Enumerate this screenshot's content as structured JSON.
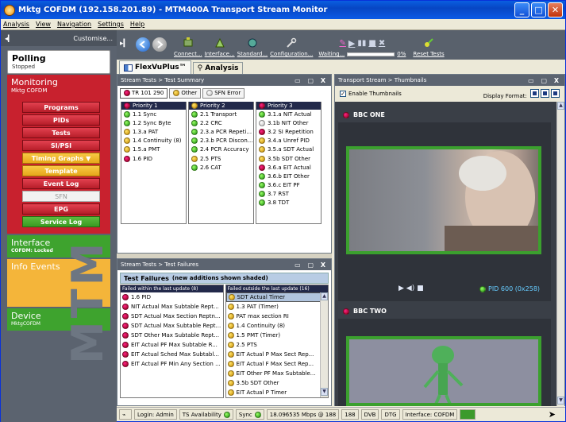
{
  "window": {
    "title": "Mktg COFDM (192.158.201.89) - MTM400A Transport Stream Monitor"
  },
  "menu": [
    "Analysis",
    "View",
    "Navigation",
    "Settings",
    "Help"
  ],
  "sidebar": {
    "header_label": "Customise...",
    "polling": {
      "title": "Polling",
      "status": "Stopped"
    },
    "monitoring": {
      "title": "Monitoring",
      "subtitle": "Mktg COFDM"
    },
    "monitoring_buttons": [
      "Programs",
      "PIDs",
      "Tests",
      "SI/PSI",
      "Timing Graphs",
      "Template",
      "Event Log",
      "SFN",
      "EPG",
      "Service Log"
    ],
    "interface": {
      "title": "Interface",
      "subtitle": "COFDM: Locked"
    },
    "info_events": {
      "title": "Info Events"
    },
    "device": {
      "title": "Device",
      "subtitle": "MktgCOFDM"
    },
    "brand_text": "MTM"
  },
  "toolbar": {
    "connect": "Connect...",
    "interface": "Interface...",
    "standard": "Standard...",
    "configuration": "Configuration...",
    "waiting": "Waiting...",
    "progress_pct": "0%",
    "progress_value": 0,
    "reset_tests": "Reset Tests"
  },
  "tabs": {
    "flexvu": "FlexVuPlus™",
    "analysis": "Analysis"
  },
  "summary_pane": {
    "header": "Stream Tests > Test Summary",
    "subtabs": [
      "TR 101 290",
      "Other",
      "SFN Error"
    ],
    "priority1": {
      "title": "Priority 1",
      "items": [
        "1.1 Sync",
        "1.2 Sync Byte",
        "1.3.a PAT",
        "1.4 Continuity (8)",
        "1.5.a PMT",
        "1.6 PID"
      ]
    },
    "priority2": {
      "title": "Priority 2",
      "items": [
        "2.1 Transport",
        "2.2 CRC",
        "2.3.a PCR Repeti...",
        "2.3.b PCR Discon...",
        "2.4 PCR Accuracy",
        "2.5 PTS",
        "2.6 CAT"
      ]
    },
    "priority3": {
      "title": "Priority 3",
      "items": [
        "3.1.a NIT Actual",
        "3.1b NIT Other",
        "3.2 SI Repetition",
        "3.4.a Unref PID",
        "3.5.a SDT Actual",
        "3.5b SDT Other",
        "3.6.a EIT Actual",
        "3.6.b EIT Other",
        "3.6.c EIT PF",
        "3.7 RST",
        "3.8 TDT"
      ]
    }
  },
  "failures_pane": {
    "header": "Stream Tests > Test Failures",
    "title": "Test Failures",
    "note": "(new additions shown shaded)",
    "within_header": "Failed within the last update (8)",
    "outside_header": "Failed outside the last update (16)",
    "within": [
      "1.6 PID",
      "NIT Actual Max Subtable Rept...",
      "SDT Actual Max Section Reptn...",
      "SDT Actual Max Subtable Rept...",
      "SDT Other Max Subtable Rept...",
      "EIT Actual PF Max Subtable R...",
      "EIT Actual Sched Max Subtabl...",
      "EIT Actual PF Min Any Section ..."
    ],
    "outside": [
      "SDT Actual Timer",
      "1.3 PAT (Timer)",
      "PAT max section RI",
      "1.4 Continuity (8)",
      "1.5 PMT (Timer)",
      "2.5 PTS",
      "EIT Actual P Max Sect Rep...",
      "EIT Actual F Max Sect Rep...",
      "EIT Other PF Max Subtable...",
      "3.5b SDT Other",
      "EIT Actual P Timer"
    ]
  },
  "thumbs_pane": {
    "header": "Transport Stream > Thumbnails",
    "enable_label": "Enable Thumbnails",
    "format_label": "Display Format:",
    "channel1": "BBC ONE",
    "pid_label": "PID 600 (0x258)",
    "channel2": "BBC TWO"
  },
  "statusbar": {
    "login": "Login: Admin",
    "ts": "TS Availability",
    "sync": "Sync",
    "rate": "18.096535 Mbps @ 188",
    "pkt": "188",
    "dvb": "DVB",
    "dtg": "DTG",
    "iface": "Interface: COFDM"
  },
  "colors": {
    "monitoring_red": "#c8212e",
    "interface_green": "#3ea32e",
    "info_orange": "#f4b53a",
    "titlebar_blue": "#0746c4"
  }
}
